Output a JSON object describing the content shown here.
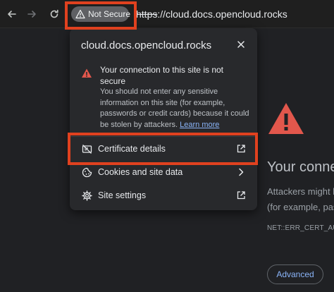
{
  "toolbar": {
    "security_badge": "Not Secure",
    "url_scheme": "https",
    "url_rest": "://cloud.docs.opencloud.rocks"
  },
  "popup": {
    "title": "cloud.docs.opencloud.rocks",
    "security_heading": "Your connection to this site is not secure",
    "security_body": "You should not enter any sensitive information on this site (for example, passwords or credit cards) because it could be stolen by attackers.",
    "learn_more": "Learn more",
    "items": [
      {
        "label": "Certificate details",
        "trailing_icon": "open-in-new-icon"
      },
      {
        "label": "Cookies and site data",
        "trailing_icon": "chevron-right-icon"
      },
      {
        "label": "Site settings",
        "trailing_icon": "open-in-new-icon"
      }
    ]
  },
  "error_page": {
    "title": "Your conne",
    "line1": "Attackers might l",
    "line2": "(for example, pas",
    "error_code": "NET::ERR_CERT_AU",
    "advanced_label": "Advanced"
  },
  "colors": {
    "highlight": "#e0411f",
    "warning": "#e2574c",
    "link": "#8ab4f8"
  }
}
